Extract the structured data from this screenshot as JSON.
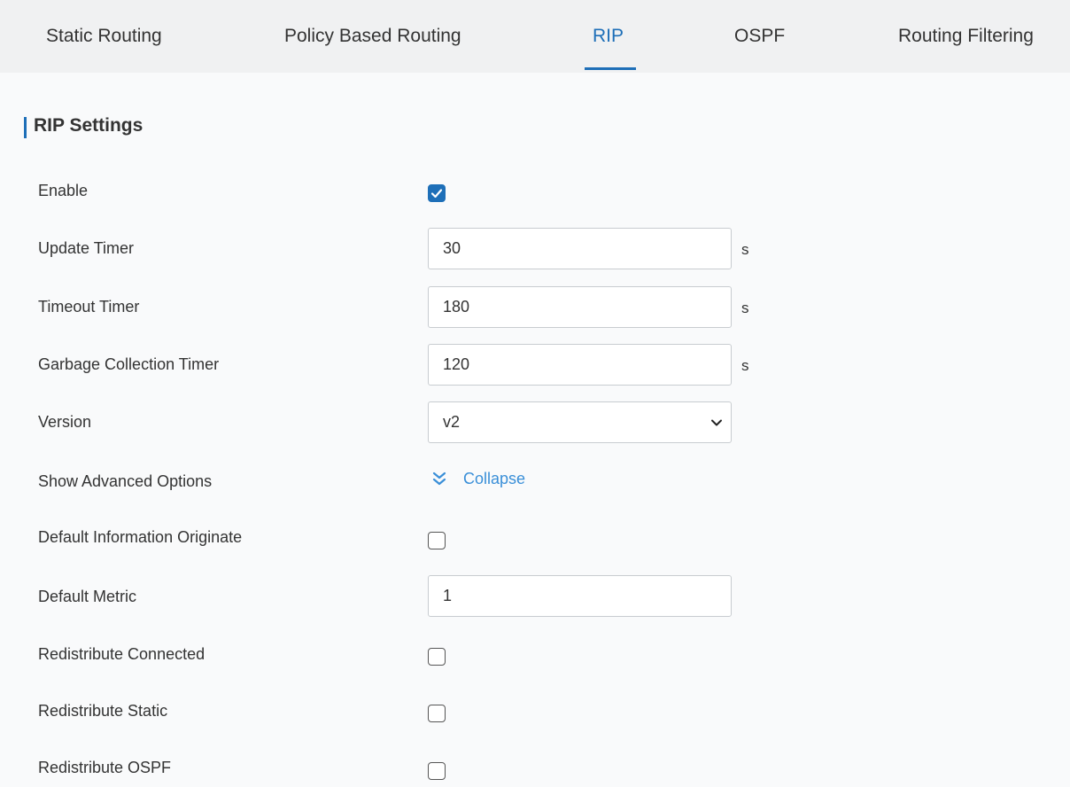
{
  "tabs": [
    {
      "label": "Static Routing",
      "active": false
    },
    {
      "label": "Policy Based Routing",
      "active": false
    },
    {
      "label": "RIP",
      "active": true
    },
    {
      "label": "OSPF",
      "active": false
    },
    {
      "label": "Routing Filtering",
      "active": false
    }
  ],
  "accent_color": "#1e6fb8",
  "section_title": "RIP Settings",
  "form": {
    "enable": {
      "label": "Enable",
      "checked": true
    },
    "update_timer": {
      "label": "Update Timer",
      "value": "30",
      "unit": "s"
    },
    "timeout_timer": {
      "label": "Timeout Timer",
      "value": "180",
      "unit": "s"
    },
    "garbage_timer": {
      "label": "Garbage Collection Timer",
      "value": "120",
      "unit": "s"
    },
    "version": {
      "label": "Version",
      "selected": "v2",
      "icon": "chevron-down-icon"
    },
    "advanced": {
      "label": "Show Advanced Options",
      "link_text": "Collapse",
      "icon": "double-chevron-down-icon"
    },
    "default_info_originate": {
      "label": "Default Information Originate",
      "checked": false
    },
    "default_metric": {
      "label": "Default Metric",
      "value": "1"
    },
    "redistribute_connected": {
      "label": "Redistribute Connected",
      "checked": false
    },
    "redistribute_static": {
      "label": "Redistribute Static",
      "checked": false
    },
    "redistribute_ospf": {
      "label": "Redistribute OSPF",
      "checked": false
    }
  }
}
